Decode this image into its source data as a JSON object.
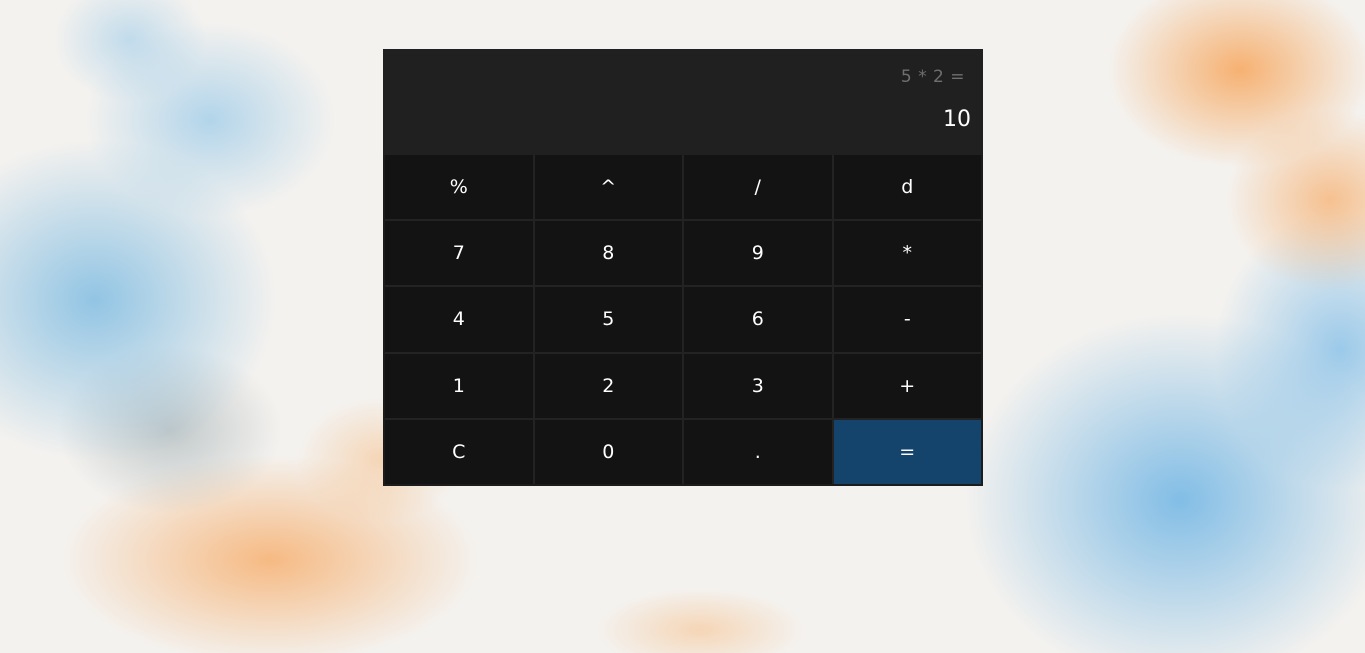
{
  "display": {
    "expression": "5 * 2 =",
    "result": "10"
  },
  "keys": {
    "percent": "%",
    "power": "^",
    "divide": "/",
    "d": "d",
    "seven": "7",
    "eight": "8",
    "nine": "9",
    "multiply": "*",
    "four": "4",
    "five": "5",
    "six": "6",
    "minus": "-",
    "one": "1",
    "two": "2",
    "three": "3",
    "plus": "+",
    "clear": "C",
    "zero": "0",
    "decimal": ".",
    "equals": "="
  },
  "colors": {
    "display_bg": "#202020",
    "key_bg": "#131313",
    "equals_bg": "#14446b",
    "expression_text": "#6f6f6f",
    "result_text": "#ffffff"
  }
}
